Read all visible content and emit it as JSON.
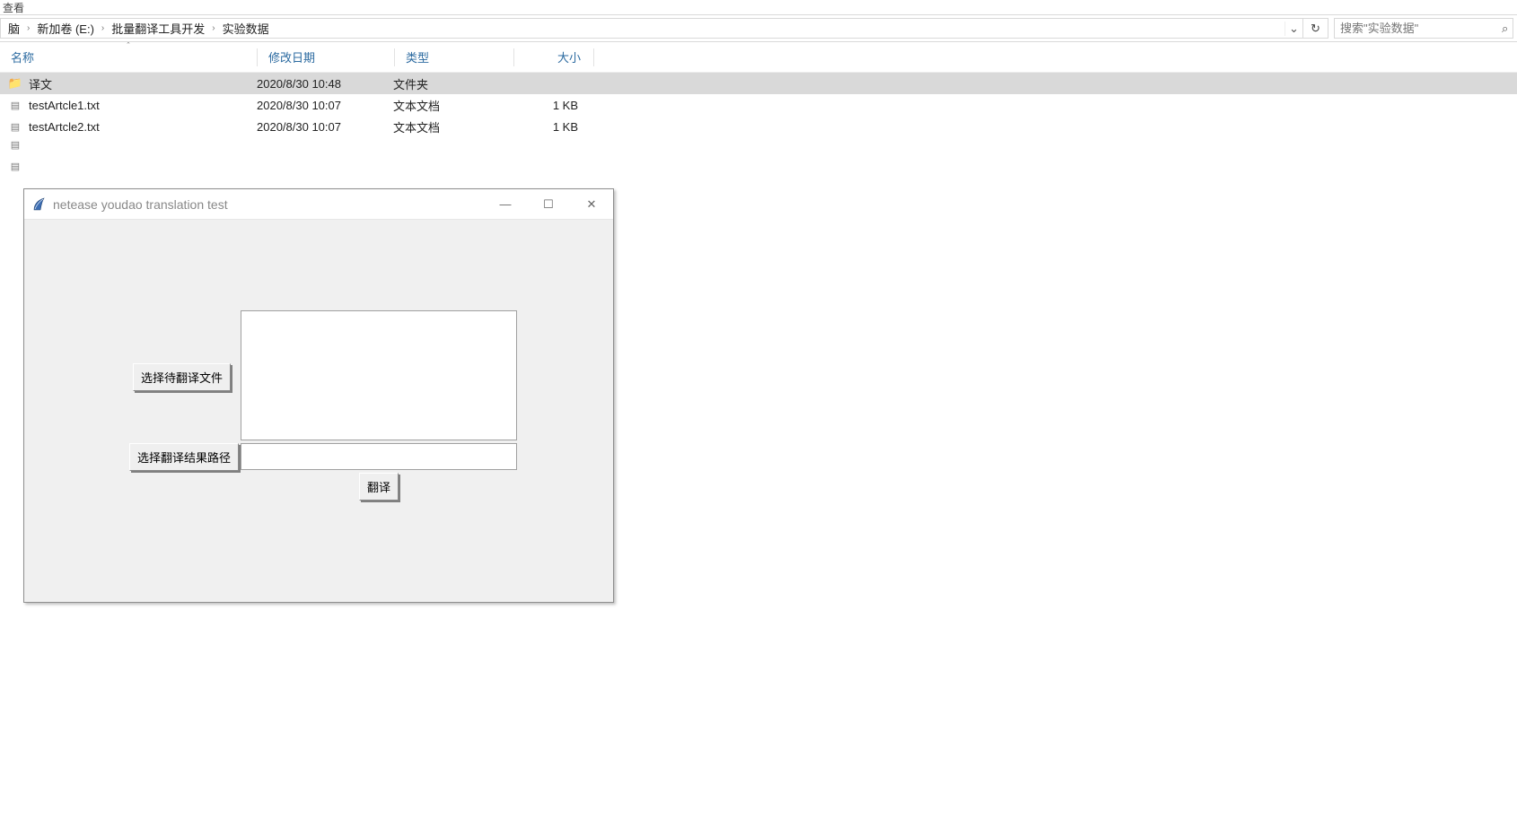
{
  "ribbon": {
    "tab_view": "查看"
  },
  "breadcrumb": {
    "segments": [
      "脑",
      "新加卷 (E:)",
      "批量翻译工具开发",
      "实验数据"
    ],
    "dropdown_glyph": "⌄",
    "refresh_glyph": "↻"
  },
  "search": {
    "placeholder": "搜索\"实验数据\"",
    "icon_glyph": "⌕"
  },
  "columns": {
    "name": "名称",
    "date": "修改日期",
    "type": "类型",
    "size": "大小",
    "sort_glyph": "ˆ"
  },
  "files": [
    {
      "icon": "folder",
      "name": "译文",
      "date": "2020/8/30 10:48",
      "type": "文件夹",
      "size": "",
      "selected": true
    },
    {
      "icon": "text",
      "name": "testArtcle1.txt",
      "date": "2020/8/30 10:07",
      "type": "文本文档",
      "size": "1 KB",
      "selected": false
    },
    {
      "icon": "text",
      "name": "testArtcle2.txt",
      "date": "2020/8/30 10:07",
      "type": "文本文档",
      "size": "1 KB",
      "selected": false
    }
  ],
  "tk": {
    "title": "netease youdao translation test",
    "btn_select_files": "选择待翻译文件",
    "btn_select_output": "选择翻译结果路径",
    "btn_translate": "翻译",
    "min_glyph": "—",
    "max_glyph": "☐",
    "close_glyph": "✕"
  }
}
